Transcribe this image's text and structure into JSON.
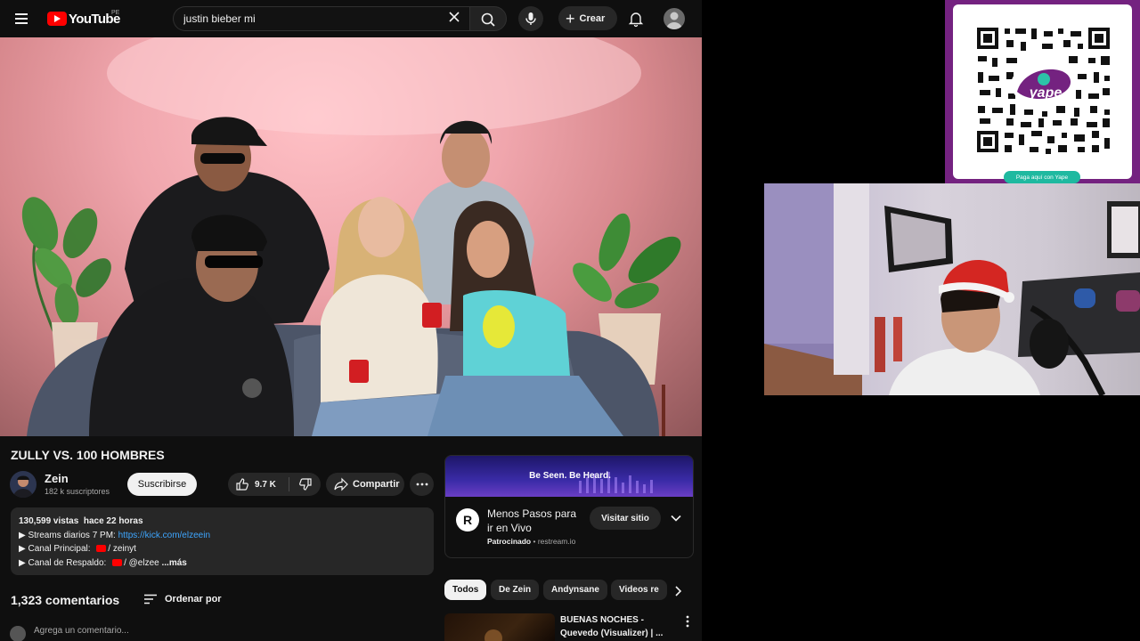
{
  "youtube": {
    "logo": {
      "text": "YouTube",
      "country": "PE"
    },
    "search": {
      "value": "justin bieber mi"
    },
    "create_label": "Crear",
    "video": {
      "title": "ZULLY VS. 100 HOMBRES",
      "channel_name": "Zein",
      "subscribers": "182 k suscriptores",
      "subscribe_label": "Suscribirse",
      "likes": "9.7 K",
      "share_label": "Compartir"
    },
    "description": {
      "views": "130,599 vistas",
      "age": "hace 22 horas",
      "line1_text": "▶ Streams diarios 7 PM: ",
      "line1_link": "https://kick.com/elzeein",
      "line2_text": "▶ Canal Principal: ",
      "line2_handle": "/ zeinyt",
      "line3_text": "▶ Canal de Respaldo: ",
      "line3_handle": "/ @elzee",
      "more_label": "...más"
    },
    "comments": {
      "count": "1,323 comentarios",
      "sort_label": "Ordenar por",
      "placeholder": "Agrega un comentario..."
    },
    "ad": {
      "banner_text": "Be Seen. Be Heard.",
      "logo_letter": "R",
      "title": "Menos Pasos para ir en Vivo",
      "sponsor_label": "Patrocinado",
      "sponsor_domain": "restream.io",
      "visit_label": "Visitar sitio"
    },
    "chips": [
      "Todos",
      "De Zein",
      "Andynsane",
      "Videos re"
    ],
    "recommended": {
      "title_line1": "BUENAS NOCHES -",
      "title_line2": "Quevedo (Visualizer) | ..."
    }
  },
  "qr": {
    "brand": "yape",
    "caption": "Paga aquí con Yape"
  }
}
